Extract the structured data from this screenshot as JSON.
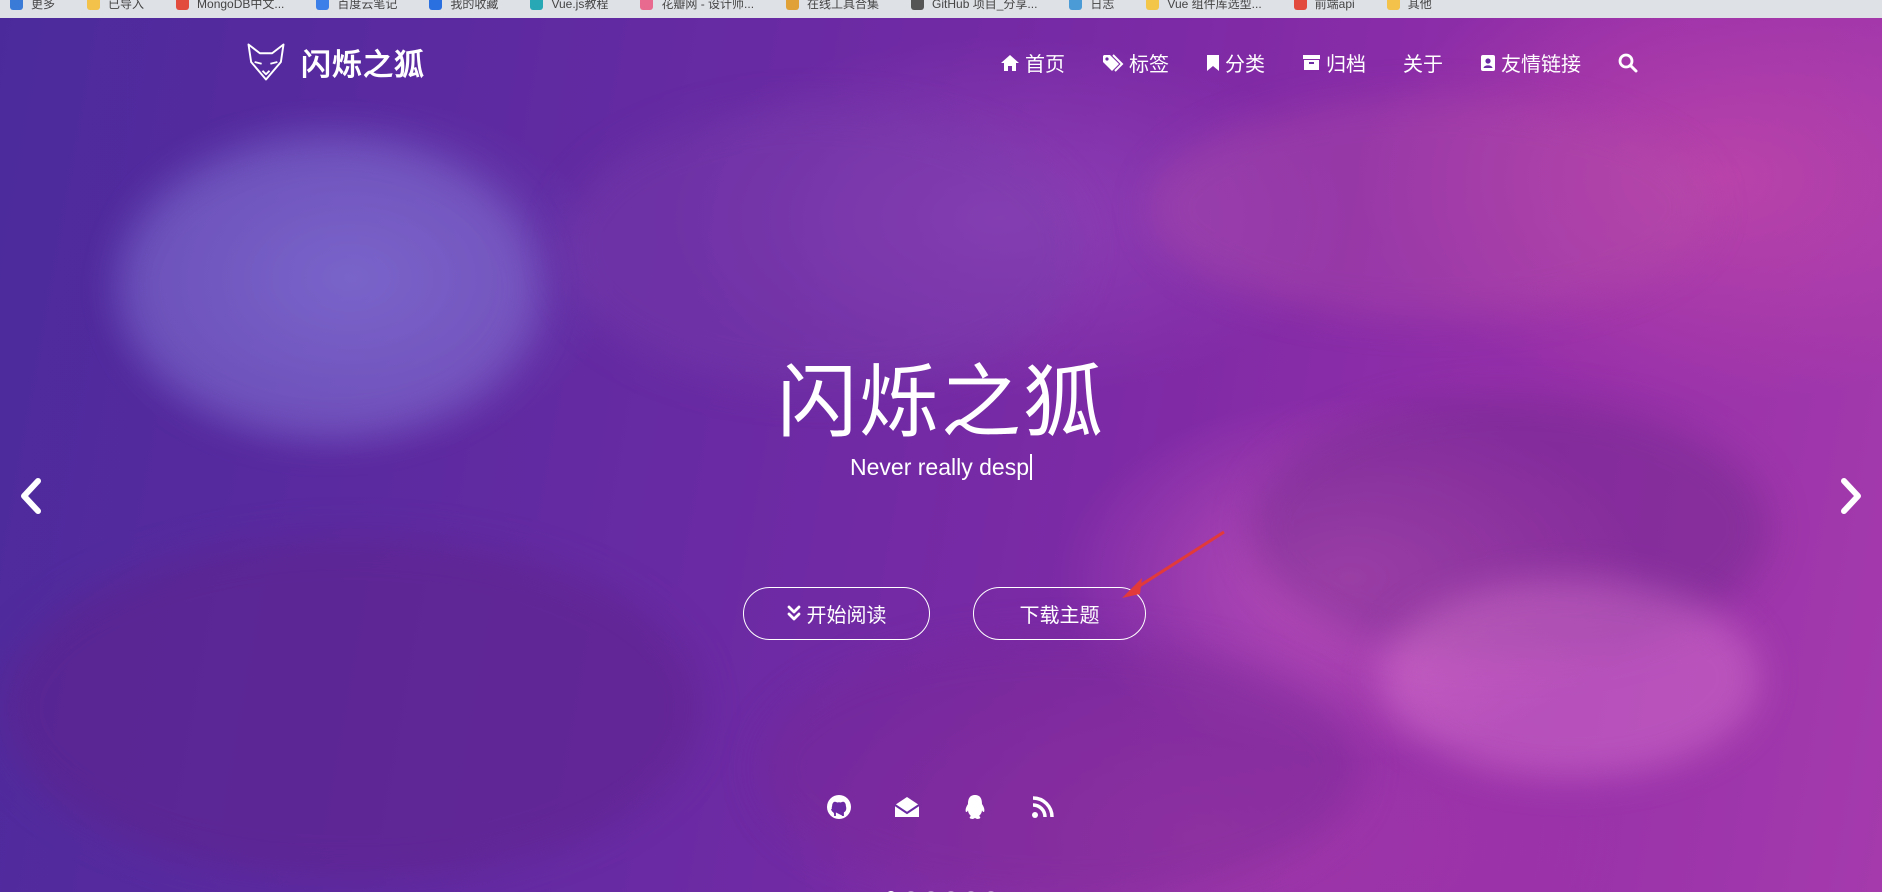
{
  "bookmarks": [
    {
      "label": "更多",
      "color": "#3b7bd8"
    },
    {
      "label": "已导入",
      "color": "#f2c24a"
    },
    {
      "label": "MongoDB中文...",
      "color": "#e24c3c"
    },
    {
      "label": "百度云笔记",
      "color": "#3d7fe8"
    },
    {
      "label": "我的收藏",
      "color": "#2b70e0"
    },
    {
      "label": "Vue.js教程",
      "color": "#28a7b5"
    },
    {
      "label": "花瓣网 - 设计师...",
      "color": "#e86a8f"
    },
    {
      "label": "在线工具合集",
      "color": "#e0a237"
    },
    {
      "label": "GitHub 项目_分享...",
      "color": "#555555"
    },
    {
      "label": "日志",
      "color": "#4a9bd6"
    },
    {
      "label": "Vue 组件库选型...",
      "color": "#f3c64a"
    },
    {
      "label": "前端api",
      "color": "#e34a3e"
    },
    {
      "label": "其他",
      "color": "#f2c24a"
    }
  ],
  "brand": {
    "name": "闪烁之狐"
  },
  "nav": {
    "home": "首页",
    "tags": "标签",
    "categories": "分类",
    "archives": "归档",
    "about": "关于",
    "friends": "友情链接"
  },
  "hero": {
    "title": "闪烁之狐",
    "subtitle": "Never really desp",
    "read_button": "开始阅读",
    "download_button": "下载主题"
  },
  "social_icons": [
    "github-icon",
    "email-icon",
    "qq-icon",
    "rss-icon"
  ],
  "carousel": {
    "total": 6,
    "active": 1
  },
  "colors": {
    "accent_arrow": "#e23a3a",
    "hero_base": "#6a2aa3"
  }
}
